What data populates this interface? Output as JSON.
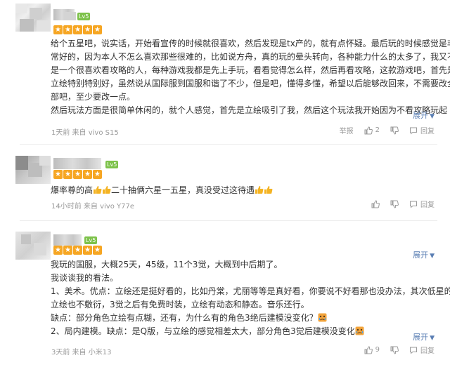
{
  "reviews": [
    {
      "rating": 5,
      "level_badge": "Lv5",
      "lines": [
        "给个五星吧，说实话，开始看宣传的时候就很喜欢，然后发现是tx产的，就有点怀疑。最后玩的时候感觉是非",
        "常好的，因为本人不怎么喜欢那些很难的，比如说方舟，真的玩的晕头转向，各种能力什么的太多了，我又不",
        "是一个很喜欢看攻略的人，每种游戏我都是先上手玩，看看觉得怎么样，然后再看攻略，这款游戏吧，首先是",
        "立绘特别特别好，虽然说从国际服到国服和谐了不少，但是吧，懂得多懂，希望以后能够改回来，不需要改全",
        "部吧，至少要改一点。",
        "然后玩法方面是很简单休闲的，就个人感觉，首先是立绘吸引了我，然后这个玩法我开始因为不看攻略玩起"
      ],
      "expand_label": "展开",
      "meta": "1天前 来自 vivo S15",
      "report_label": "举报",
      "likes": "2",
      "reply_label": "回复"
    },
    {
      "rating": 5,
      "level_badge": "Lv5",
      "line_parts": [
        "爆率尊的高",
        "二十抽俩六星一五星，真没受过这待遇"
      ],
      "meta": "14小时前 来自 vivo Y77e",
      "likes": "",
      "reply_label": "回复"
    },
    {
      "rating": 5,
      "level_badge": "Lv5",
      "lines": [
        "我玩的国服，大概25天，45级，11个3觉，大概到中后期了。",
        "我谈谈我的看法。",
        "1、美术。优点：立绘还是挺好看的，比如丹棠，尤丽等等是真好看，你要说不好看那也没办法，其次低星的",
        "立绘也不敷衍，3觉之后有免费时装，立绘有动态和静态。音乐还行。",
        "缺点：部分角色立绘有点糊，还有，为什么有的角色3绝后建模没变化？",
        "2、局内建模。缺点：是Q版，与立绘的感觉相差太大，部分角色3觉后建模没变化"
      ],
      "expand_label": "展开",
      "meta": "3天前 来自 小米13",
      "likes": "9",
      "reply_label": "回复"
    }
  ],
  "colors": {
    "star": "#f6a623",
    "level_badge": "#7dc24a",
    "expand_link": "#5b7fb4",
    "meta_text": "#999999",
    "body_text": "#333333"
  },
  "icons": {
    "rating": "star-icon",
    "like": "thumbs-up-icon",
    "dislike": "thumbs-down-icon",
    "reply": "comment-icon",
    "expand": "chevron-down-icon",
    "emoji_thumb": "thumbs-up-emoji",
    "emoji_cry": "crying-face-emoji"
  }
}
